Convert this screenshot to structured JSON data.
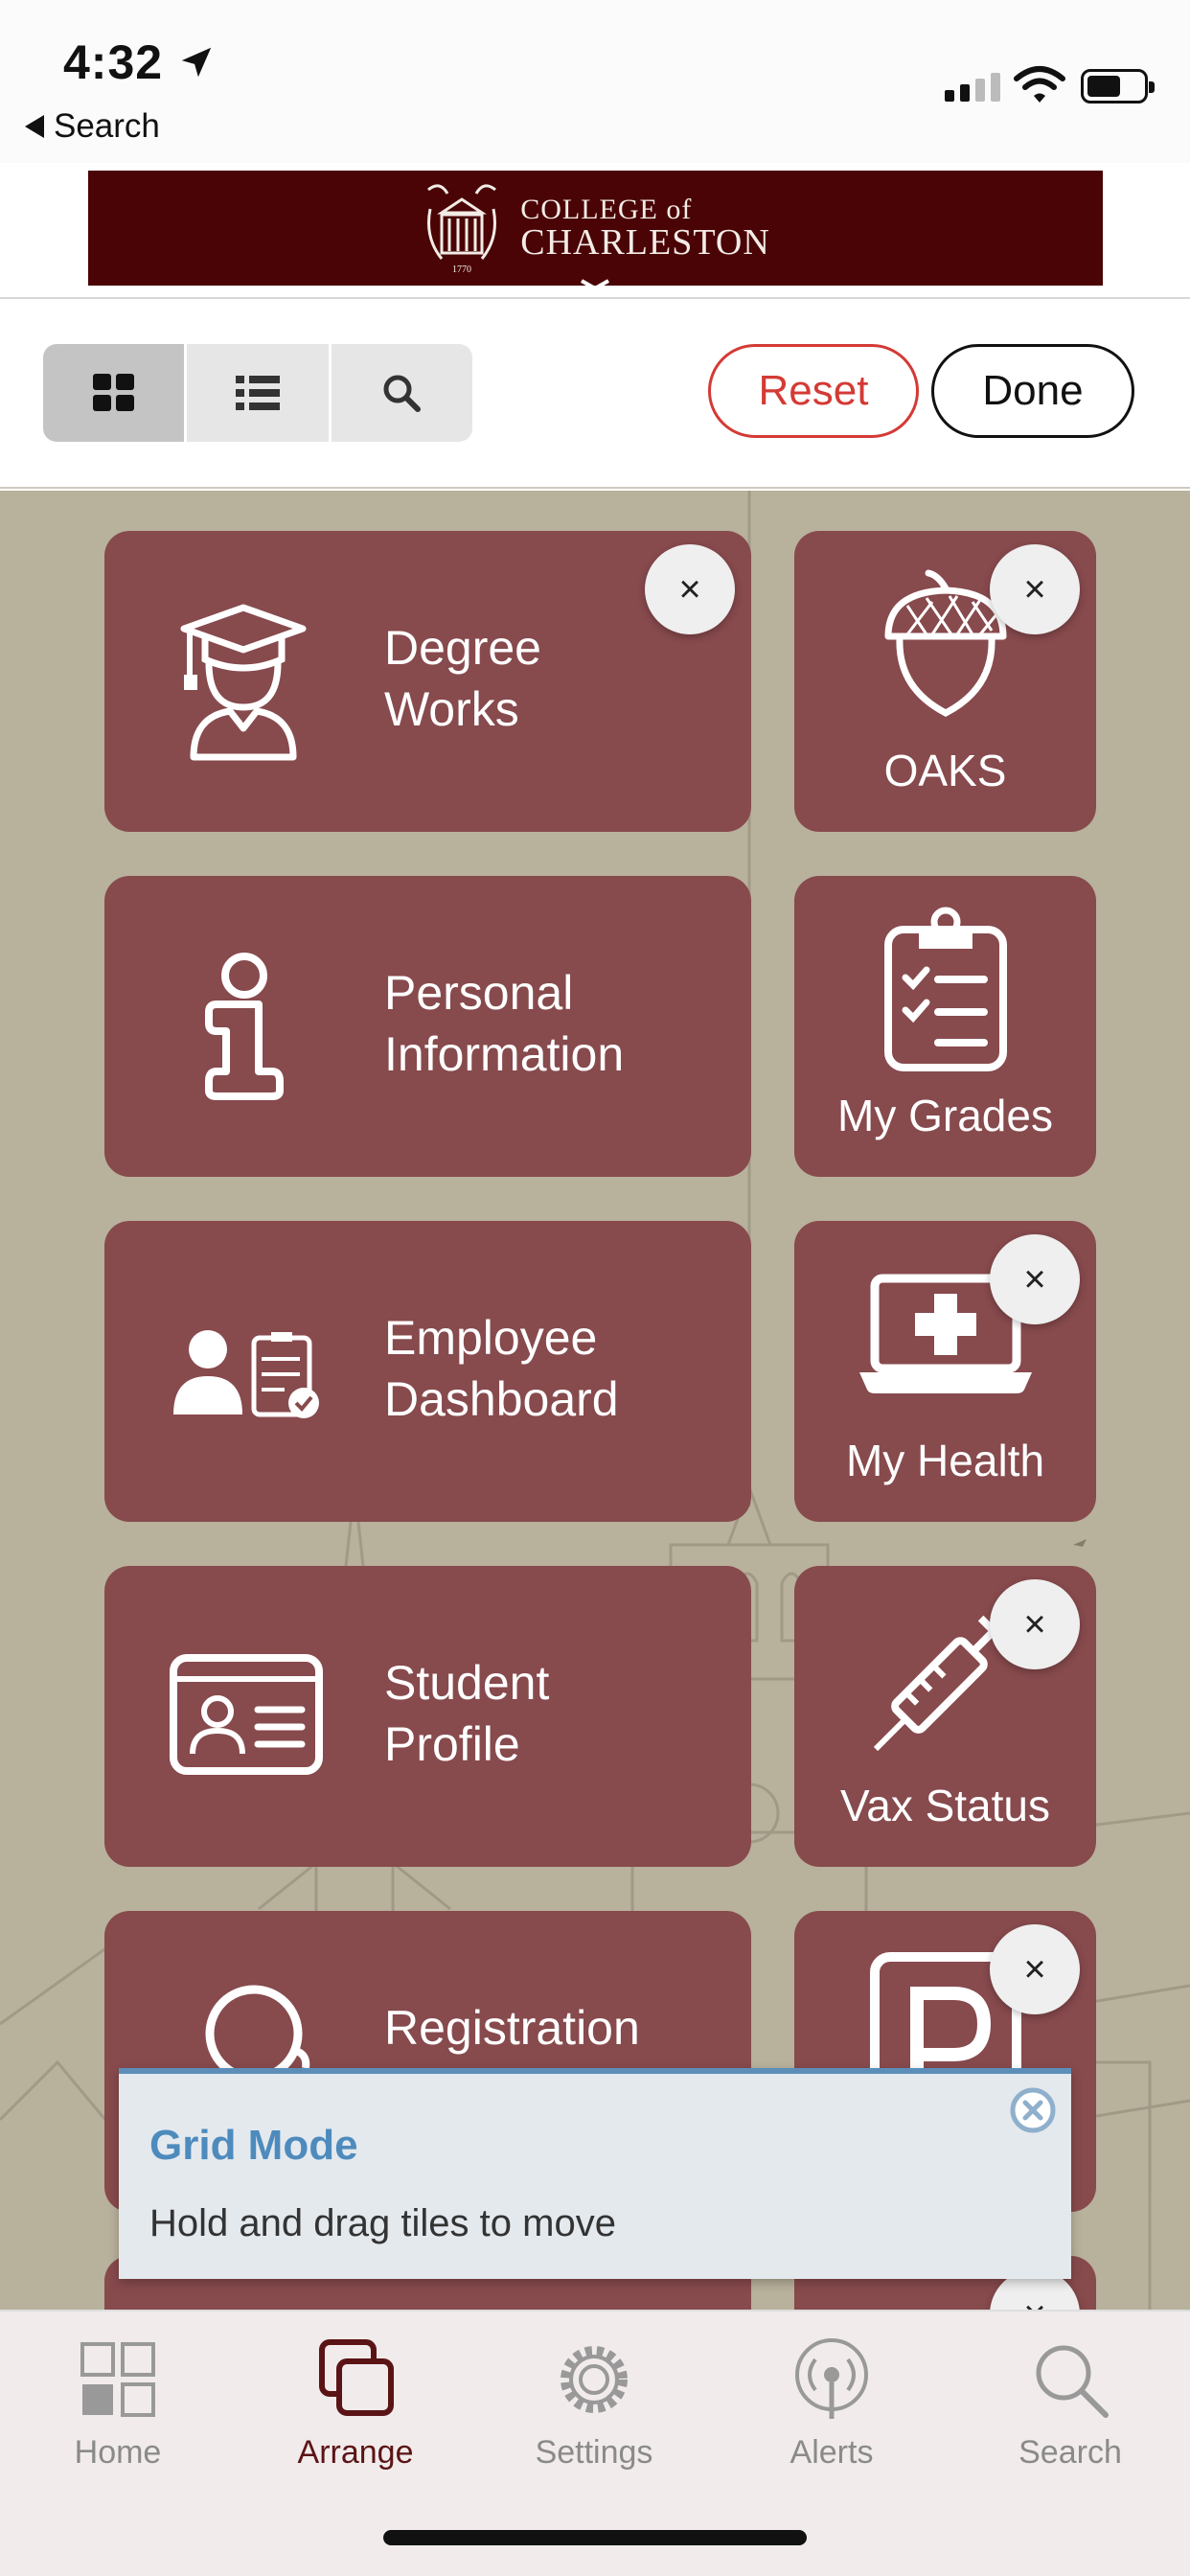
{
  "status_bar": {
    "time": "4:32",
    "back_label": "Search"
  },
  "banner": {
    "line1": "COLLEGE of",
    "line2": "CHARLESTON",
    "year": "1770"
  },
  "toolbar": {
    "view_modes": [
      "grid-icon",
      "list-icon",
      "search-icon"
    ],
    "active_view": "grid",
    "reset_label": "Reset",
    "done_label": "Done"
  },
  "tiles": {
    "degree_works": {
      "label_l1": "Degree",
      "label_l2": "Works"
    },
    "oaks": {
      "label": "OAKS"
    },
    "personal_info": {
      "label_l1": "Personal",
      "label_l2": "Information"
    },
    "my_grades": {
      "label": "My Grades"
    },
    "employee_dashboard": {
      "label_l1": "Employee",
      "label_l2": "Dashboard"
    },
    "my_health": {
      "label": "My Health"
    },
    "student_profile": {
      "label_l1": "Student",
      "label_l2": "Profile"
    },
    "vax_status": {
      "label": "Vax Status"
    },
    "registration": {
      "label": "Registration"
    }
  },
  "remove_symbol": "×",
  "toast": {
    "title": "Grid Mode",
    "message": "Hold and drag tiles to move"
  },
  "tabbar": {
    "tabs": [
      {
        "label": "Home",
        "icon": "grid-squares-icon"
      },
      {
        "label": "Arrange",
        "icon": "arrange-icon"
      },
      {
        "label": "Settings",
        "icon": "gear-icon"
      },
      {
        "label": "Alerts",
        "icon": "broadcast-icon"
      },
      {
        "label": "Search",
        "icon": "search-icon"
      }
    ],
    "active": "Arrange"
  },
  "colors": {
    "tile": "#874a4d",
    "banner": "#4a0406",
    "background": "#b8b19c",
    "reset": "#d43a35",
    "toast_accent": "#5b8fb9",
    "active_tab": "#5b1416"
  }
}
